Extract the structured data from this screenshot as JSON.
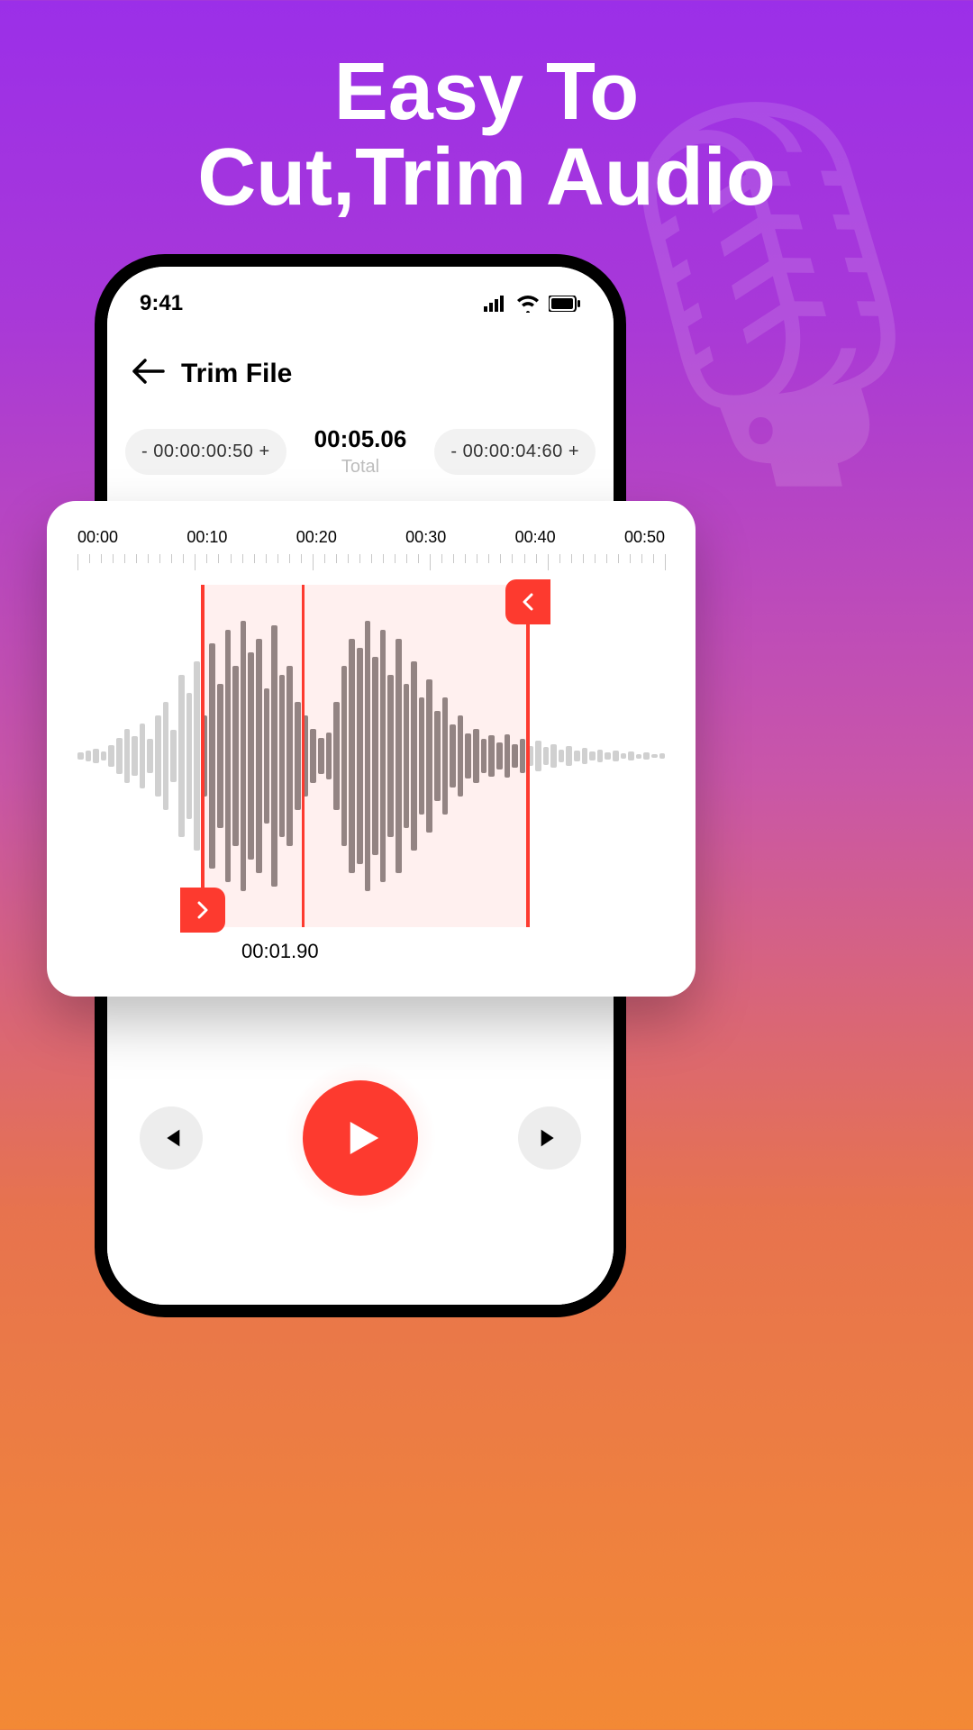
{
  "hero": {
    "line1": "Easy To",
    "line2": "Cut,Trim Audio"
  },
  "status": {
    "time": "9:41"
  },
  "header": {
    "title": "Trim File"
  },
  "trim": {
    "left_pill_minus": "-",
    "left_pill_value": "00:00:00:50",
    "left_pill_plus": "+",
    "right_pill_minus": "-",
    "right_pill_value": "00:00:04:60",
    "right_pill_plus": "+",
    "total_time": "00:05.06",
    "total_label": "Total"
  },
  "ruler": {
    "labels": [
      "00:00",
      "00:10",
      "00:20",
      "00:30",
      "00:40",
      "00:50"
    ]
  },
  "selection": {
    "start_pct": 21,
    "end_pct": 77,
    "mid_pct": 38,
    "current_time": "00:01.90"
  },
  "wave_heights": [
    8,
    12,
    16,
    10,
    24,
    40,
    60,
    44,
    72,
    38,
    90,
    120,
    58,
    180,
    140,
    210,
    90,
    250,
    160,
    280,
    200,
    300,
    230,
    260,
    150,
    290,
    180,
    200,
    120,
    90,
    60,
    40,
    52,
    120,
    200,
    260,
    240,
    300,
    220,
    280,
    180,
    260,
    160,
    210,
    130,
    170,
    100,
    130,
    70,
    90,
    50,
    60,
    38,
    46,
    30,
    48,
    26,
    38,
    22,
    34,
    20,
    26,
    14,
    22,
    12,
    18,
    10,
    14,
    8,
    12,
    6,
    10,
    5,
    8,
    4,
    6
  ],
  "colors": {
    "accent": "#fd3a2f"
  }
}
